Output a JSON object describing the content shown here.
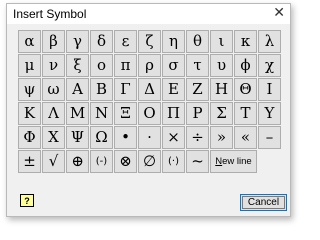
{
  "window": {
    "title": "Insert Symbol",
    "close_glyph": "✕"
  },
  "symbols": [
    [
      "α",
      "β",
      "γ",
      "δ",
      "ε",
      "ζ",
      "η",
      "θ",
      "ι",
      "κ",
      "λ"
    ],
    [
      "μ",
      "ν",
      "ξ",
      "ο",
      "π",
      "ρ",
      "σ",
      "τ",
      "υ",
      "ϕ",
      "χ"
    ],
    [
      "ψ",
      "ω",
      "Α",
      "Β",
      "Γ",
      "Δ",
      "Ε",
      "Ζ",
      "Η",
      "Θ",
      "Ι"
    ],
    [
      "Κ",
      "Λ",
      "Μ",
      "Ν",
      "Ξ",
      "Ο",
      "Π",
      "Ρ",
      "Σ",
      "Τ",
      "Υ"
    ],
    [
      "Φ",
      "Χ",
      "Ψ",
      "Ω",
      "•",
      "·",
      "×",
      "÷",
      "»",
      "«",
      "–"
    ],
    [
      "±",
      "√",
      "⊕",
      "(-)",
      "⊗",
      "∅",
      "(·)",
      "~"
    ]
  ],
  "newline_button": {
    "label_prefix": "N",
    "label_rest": "ew line"
  },
  "help_button": {
    "label": "?"
  },
  "cancel_button": {
    "label": "Cancel"
  }
}
